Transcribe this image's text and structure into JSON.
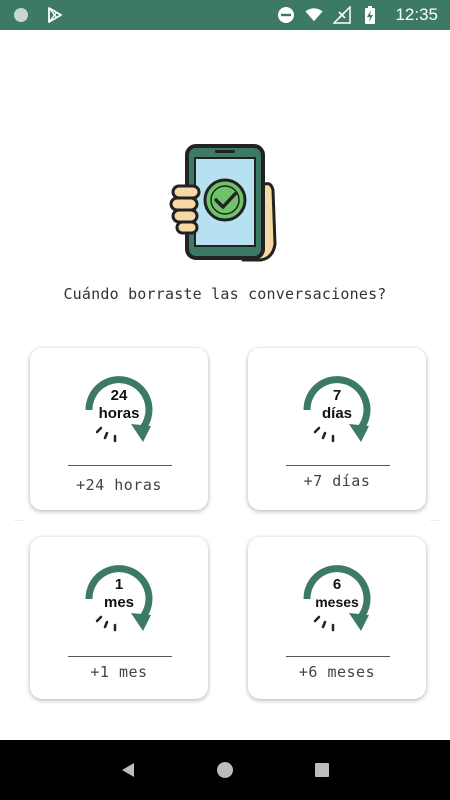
{
  "status_bar": {
    "time": "12:35",
    "background_color": "#3d7a66",
    "icons_left": [
      "circle-notification-icon",
      "play-store-icon"
    ],
    "icons_right": [
      "do-not-disturb-icon",
      "wifi-icon",
      "no-signal-icon",
      "battery-charging-icon"
    ]
  },
  "hero": {
    "icon": "phone-checkmark-in-hand-icon"
  },
  "prompt": "Cuándo borraste las conversaciones?",
  "accent_color": "#3d7a66",
  "options": [
    {
      "icon_top": "24",
      "icon_bottom": "horas",
      "label": "+24 horas"
    },
    {
      "icon_top": "7",
      "icon_bottom": "días",
      "label": "+7 días"
    },
    {
      "icon_top": "1",
      "icon_bottom": "mes",
      "label": "+1 mes"
    },
    {
      "icon_top": "6",
      "icon_bottom": "meses",
      "label": "+6 meses"
    }
  ],
  "nav_bar": {
    "buttons": [
      "back-icon",
      "home-icon",
      "recents-icon"
    ]
  }
}
